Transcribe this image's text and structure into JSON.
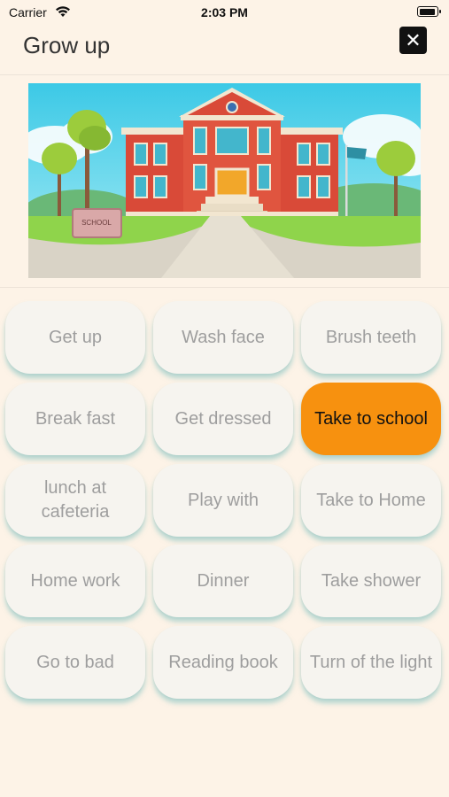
{
  "status": {
    "carrier": "Carrier",
    "time": "2:03 PM"
  },
  "header": {
    "title": "Grow up",
    "close_icon": "close-icon"
  },
  "hero": {
    "sign_text": "SCHOOL"
  },
  "tiles": [
    {
      "label": "Get up",
      "active": false
    },
    {
      "label": "Wash face",
      "active": false
    },
    {
      "label": "Brush teeth",
      "active": false
    },
    {
      "label": "Break fast",
      "active": false
    },
    {
      "label": "Get dressed",
      "active": false
    },
    {
      "label": "Take to school",
      "active": true
    },
    {
      "label": "lunch at cafeteria",
      "active": false
    },
    {
      "label": "Play with",
      "active": false
    },
    {
      "label": "Take to Home",
      "active": false
    },
    {
      "label": "Home work",
      "active": false
    },
    {
      "label": "Dinner",
      "active": false
    },
    {
      "label": "Take shower",
      "active": false
    },
    {
      "label": "Go to bad",
      "active": false
    },
    {
      "label": "Reading book",
      "active": false
    },
    {
      "label": "Turn of the light",
      "active": false
    }
  ],
  "colors": {
    "background": "#fdf3e7",
    "tile": "#f6f4ef",
    "active_tile": "#f7910f",
    "tile_text": "#9e9e9e"
  }
}
